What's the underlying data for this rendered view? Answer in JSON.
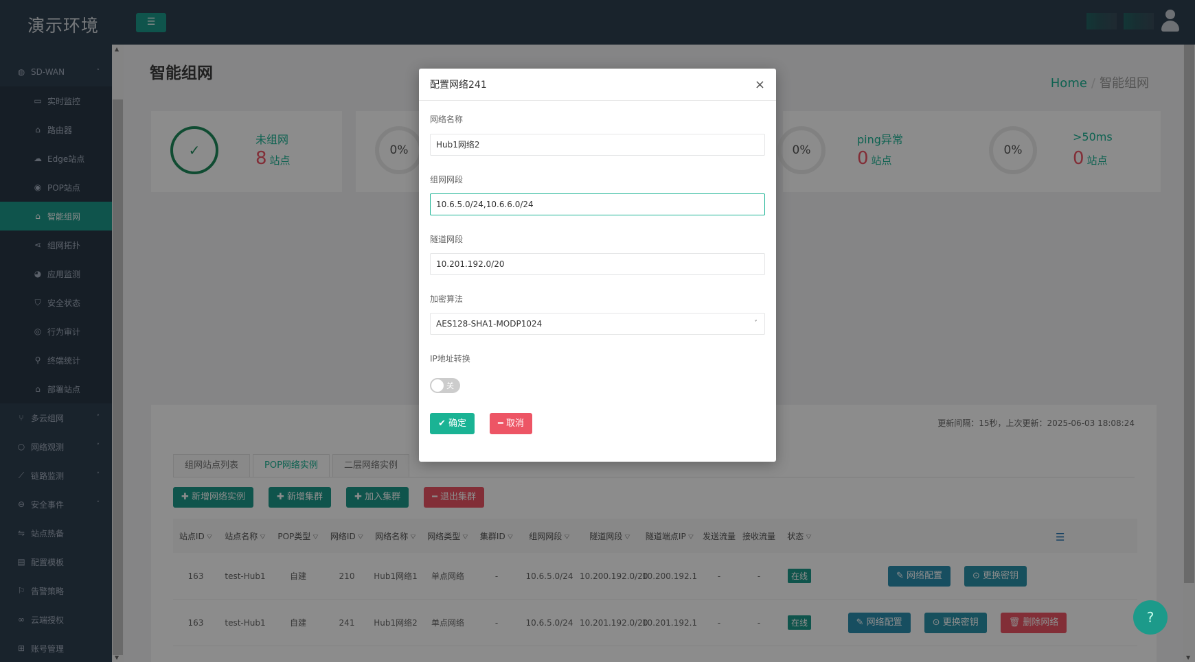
{
  "app": {
    "brand": "演示环境",
    "menu_toggle_icon": "☰"
  },
  "sidebar": {
    "items": [
      {
        "label": "SD-WAN",
        "icon": "globe-icon",
        "glyph": "◍",
        "type": "group",
        "caret": "˄"
      },
      {
        "label": "实时监控",
        "icon": "monitor-icon",
        "glyph": "▭",
        "type": "sub"
      },
      {
        "label": "路由器",
        "icon": "router-icon",
        "glyph": "⌂",
        "type": "sub"
      },
      {
        "label": "Edge站点",
        "icon": "cloud-icon",
        "glyph": "☁",
        "type": "sub"
      },
      {
        "label": "POP站点",
        "icon": "location-icon",
        "glyph": "◉",
        "type": "sub"
      },
      {
        "label": "智能组网",
        "icon": "network-icon",
        "glyph": "⌂",
        "type": "sub",
        "active": true
      },
      {
        "label": "组网拓扑",
        "icon": "share-icon",
        "glyph": "⋖",
        "type": "sub"
      },
      {
        "label": "应用监测",
        "icon": "pie-chart-icon",
        "glyph": "◕",
        "type": "sub"
      },
      {
        "label": "安全状态",
        "icon": "shield-icon",
        "glyph": "⛉",
        "type": "sub"
      },
      {
        "label": "行为审计",
        "icon": "eye-icon",
        "glyph": "◎",
        "type": "sub"
      },
      {
        "label": "终端统计",
        "icon": "search-icon",
        "glyph": "⚲",
        "type": "sub"
      },
      {
        "label": "部署站点",
        "icon": "deploy-icon",
        "glyph": "⌂",
        "type": "sub"
      },
      {
        "label": "多云组网",
        "icon": "fork-icon",
        "glyph": "⑂",
        "type": "group",
        "caret": "˅"
      },
      {
        "label": "网络观测",
        "icon": "circle-icon",
        "glyph": "○",
        "type": "group",
        "caret": "˅"
      },
      {
        "label": "链路监测",
        "icon": "line-chart-icon",
        "glyph": "⟋",
        "type": "group",
        "caret": "˅"
      },
      {
        "label": "安全事件",
        "icon": "minus-circle-icon",
        "glyph": "⊖",
        "type": "group",
        "caret": "˅"
      },
      {
        "label": "站点热备",
        "icon": "exchange-icon",
        "glyph": "⇋",
        "type": "group"
      },
      {
        "label": "配置模板",
        "icon": "file-icon",
        "glyph": "▤",
        "type": "group"
      },
      {
        "label": "告警策略",
        "icon": "flag-icon",
        "glyph": "⚐",
        "type": "group"
      },
      {
        "label": "云端授权",
        "icon": "link-icon",
        "glyph": "∞",
        "type": "group"
      },
      {
        "label": "账号管理",
        "icon": "sitemap-icon",
        "glyph": "⊞",
        "type": "group"
      }
    ]
  },
  "page": {
    "title": "智能组网",
    "breadcrumb_home": "Home",
    "breadcrumb_sep": "/",
    "breadcrumb_current": "智能组网"
  },
  "stats": [
    {
      "ring": "✓",
      "label": "未组网",
      "value": "8",
      "unit": "站点"
    },
    {
      "ring": "0%"
    },
    {
      "ring": "0%",
      "label": "ping异常",
      "value": "0",
      "unit": "站点"
    },
    {
      "ring": "0%",
      "label": ">50ms",
      "value": "0",
      "unit": "站点"
    }
  ],
  "panel": {
    "update_info": "更新间隔：15秒，上次更新：2025-06-03 18:08:24",
    "tabs": [
      "组网站点列表",
      "POP网络实例",
      "二层网络实例"
    ],
    "actions": [
      {
        "label": "✚ 新增网络实例",
        "color": "#1c9a8a"
      },
      {
        "label": "✚ 新增集群",
        "color": "#1c9a8a"
      },
      {
        "label": "✚ 加入集群",
        "color": "#1c9a8a"
      },
      {
        "label": "━ 退出集群",
        "color": "#ed5565"
      }
    ],
    "columns": [
      "站点ID",
      "站点名称",
      "POP类型",
      "网络ID",
      "网络名称",
      "网络类型",
      "集群ID",
      "组网网段",
      "隧道网段",
      "隧道端点IP",
      "发送流量",
      "接收流量",
      "状态"
    ],
    "filter_icon": "⛛",
    "list_icon": "☰",
    "rows": [
      {
        "site_id": "163",
        "site_name": "test-Hub1",
        "pop_type": "自建",
        "net_id": "210",
        "net_name": "Hub1网络1",
        "net_type": "单点网络",
        "cluster_id": "-",
        "lan": "10.6.5.0/24",
        "tunnel": "10.200.192.0/20",
        "endpoint": "10.200.192.1",
        "tx": "-",
        "rx": "-",
        "status": "在线",
        "buttons": [
          "✎ 网络配置",
          "⊙ 更换密钥"
        ]
      },
      {
        "site_id": "163",
        "site_name": "test-Hub1",
        "pop_type": "自建",
        "net_id": "241",
        "net_name": "Hub1网络2",
        "net_type": "单点网络",
        "cluster_id": "-",
        "lan": "10.6.5.0/24",
        "tunnel": "10.201.192.0/20",
        "endpoint": "10.201.192.1",
        "tx": "-",
        "rx": "-",
        "status": "在线",
        "buttons": [
          "✎ 网络配置",
          "⊙ 更换密钥",
          "🗑 删除网络"
        ]
      }
    ]
  },
  "help_icon": "?",
  "modal": {
    "title": "配置网络241",
    "close": "×",
    "fields": {
      "name_label": "网络名称",
      "name_value": "Hub1网络2",
      "lan_label": "组网网段",
      "lan_value": "10.6.5.0/24,10.6.6.0/24",
      "tunnel_label": "隧道网段",
      "tunnel_value": "10.201.192.0/20",
      "crypto_label": "加密算法",
      "crypto_value": "AES128-SHA1-MODP1024",
      "crypto_chevron": "˅",
      "nat_label": "IP地址转换",
      "nat_toggle": "关"
    },
    "confirm": "✔ 确定",
    "cancel": "━ 取消"
  }
}
